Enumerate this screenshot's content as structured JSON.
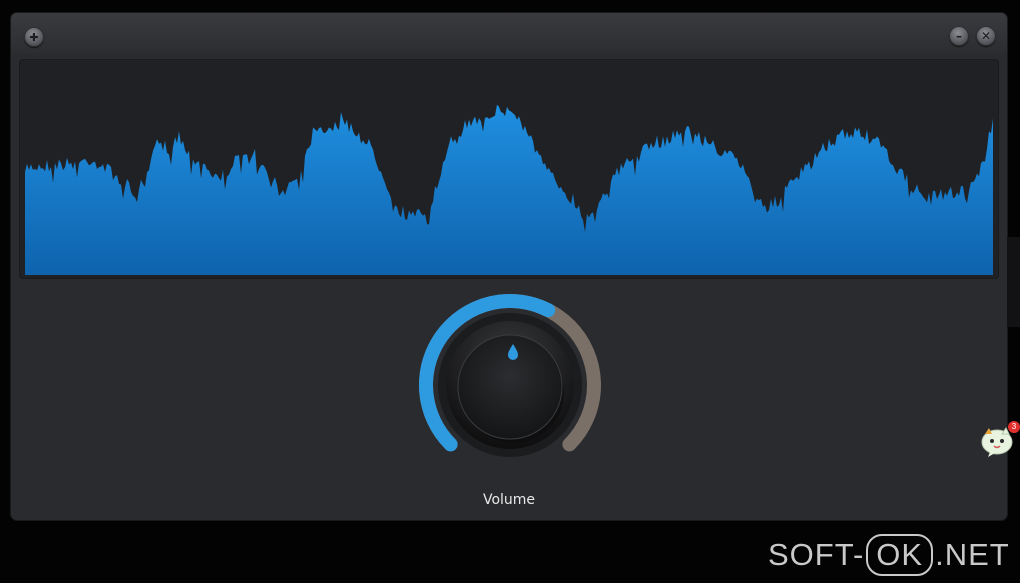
{
  "window": {
    "app_icon": "app-menu-icon",
    "minimize_icon": "minimize-icon",
    "close_icon": "close-icon"
  },
  "waveform": {
    "fill_color": "#1a84d6",
    "fill_color_dark": "#1069b4"
  },
  "knob": {
    "label": "Volume",
    "level": 0.6,
    "active_color": "#2e9ae0",
    "inactive_color": "#7a7068"
  },
  "chat_widget": {
    "icon": "chat-cat-icon",
    "badge_count": "3"
  },
  "watermark": {
    "prefix": "SOFT-",
    "middle": "OK",
    "suffix": ".NET"
  }
}
